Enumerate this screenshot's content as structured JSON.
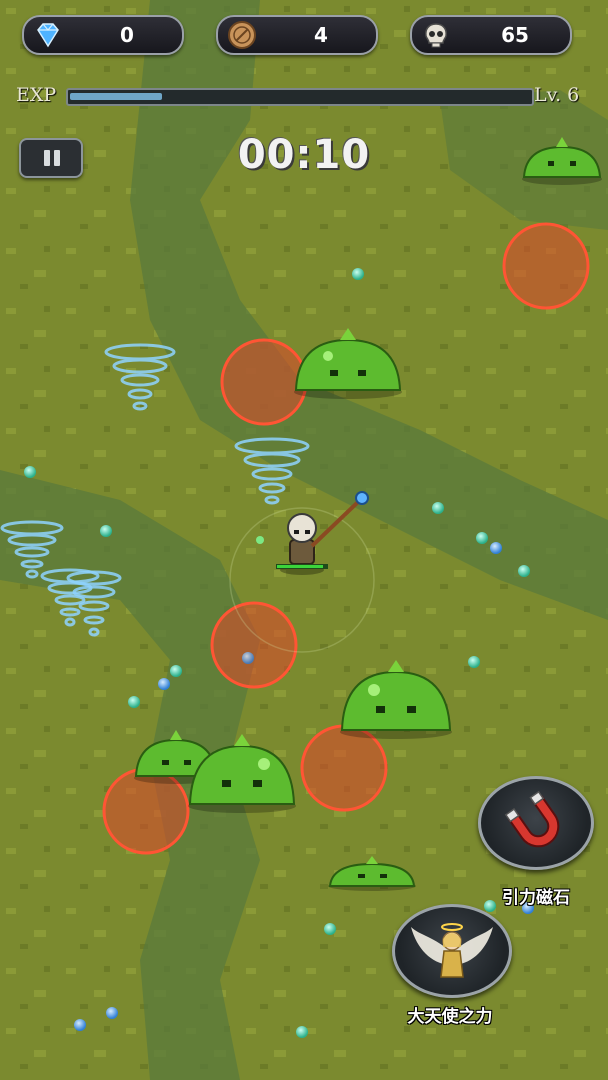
{
  "hud": {
    "gems": {
      "icon": "diamond-icon",
      "value": "0"
    },
    "coins": {
      "icon": "coin-icon",
      "value": "4"
    },
    "kills": {
      "icon": "skull-icon",
      "value": "65"
    },
    "exp_label": "EXP",
    "exp_fraction": 0.2,
    "level_label": "Lv. 6",
    "timer": "00:10",
    "pause_icon": "pause-icon"
  },
  "skills": [
    {
      "icon": "magnet-icon",
      "label": "引力磁石"
    },
    {
      "icon": "angel-icon",
      "label": "大天使之力"
    }
  ],
  "colors": {
    "ground": "#7b8a2f",
    "path": "#55733a",
    "slime": "#5dbb2f",
    "danger_zone": "#e0472b",
    "exp_fill": "#6fa6c8"
  }
}
